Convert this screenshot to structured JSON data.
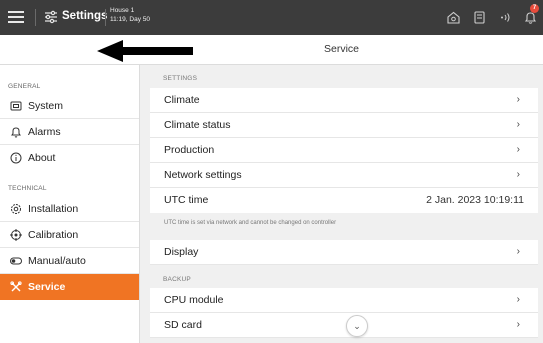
{
  "topbar": {
    "title": "Settings",
    "house_name": "House 1",
    "house_time": "11:19, Day 50",
    "notification_count": "7"
  },
  "header": {
    "page_title": "Service"
  },
  "sidebar": {
    "general_label": "GENERAL",
    "technical_label": "TECHNICAL",
    "items": [
      {
        "label": "System",
        "icon": "monitor-icon"
      },
      {
        "label": "Alarms",
        "icon": "bell-icon"
      },
      {
        "label": "About",
        "icon": "info-icon"
      },
      {
        "label": "Installation",
        "icon": "gear-icon"
      },
      {
        "label": "Calibration",
        "icon": "target-icon"
      },
      {
        "label": "Manual/auto",
        "icon": "toggle-icon"
      },
      {
        "label": "Service",
        "icon": "tools-icon",
        "active": true
      }
    ]
  },
  "main": {
    "settings_label": "SETTINGS",
    "backup_label": "BACKUP",
    "settings_rows": [
      {
        "label": "Climate",
        "chevron": "›"
      },
      {
        "label": "Climate status",
        "chevron": "›"
      },
      {
        "label": "Production",
        "chevron": "›"
      },
      {
        "label": "Network settings",
        "chevron": "›"
      }
    ],
    "utc": {
      "label": "UTC time",
      "value": "2 Jan. 2023 10:19:11"
    },
    "utc_note": "UTC time is set via network and cannot be changed on controller",
    "display": {
      "label": "Display",
      "chevron": "›"
    },
    "backup_rows": [
      {
        "label": "CPU module",
        "chevron": "›"
      },
      {
        "label": "SD card",
        "chevron": "›"
      }
    ],
    "scroll_glyph": "⌄"
  },
  "colors": {
    "accent": "#f07423",
    "topbar": "#3c3c3c",
    "badge": "#e74c3c"
  }
}
